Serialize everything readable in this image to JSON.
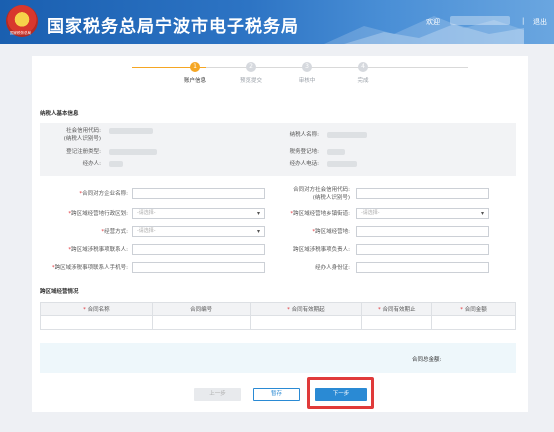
{
  "header": {
    "logo_text": "国家税务总局",
    "title": "国家税务总局宁波市电子税务局",
    "welcome": "欢迎",
    "separator": "|",
    "exit": "退出"
  },
  "steps": [
    {
      "num": "1",
      "label": "账户信息",
      "active": true
    },
    {
      "num": "2",
      "label": "预览提交",
      "active": false
    },
    {
      "num": "3",
      "label": "审核中",
      "active": false
    },
    {
      "num": "4",
      "label": "完成",
      "active": false
    }
  ],
  "basic_info": {
    "title": "纳税人基本信息",
    "fields": {
      "credit_code": "社会信用代码:",
      "credit_code_2": "(纳税人识别号)",
      "reg_type": "登记注册类型:",
      "operator": "经办人:",
      "taxpayer_name": "纳税人名称:",
      "tax_authority": "税务登记地:",
      "operator_phone": "经办人电话:"
    }
  },
  "form": {
    "counterparty_name": "合同对方企业名称:",
    "counterparty_code": "合同对方社会信用代码:",
    "counterparty_code_2": "(纳税人识别号)",
    "cross_district": "跨区域经营地行政区划:",
    "cross_street": "跨区域经营地乡镇街道:",
    "select_placeholder": "-请选择-",
    "business_mode": "经营方式:",
    "business_addr": "跨区域经营地:",
    "contact": "跨区域涉税事项联系人:",
    "manager": "跨区域涉税事项负责人:",
    "contact_phone": "跨区域涉税事项联系人手机号:",
    "operator_id": "经办人身份证:",
    "required_mark": "*"
  },
  "contract_section": {
    "title": "跨区域经营情况",
    "columns": [
      {
        "label": "合同名称",
        "required": true
      },
      {
        "label": "合同编号",
        "required": false
      },
      {
        "label": "合同有效期起",
        "required": true
      },
      {
        "label": "合同有效期止",
        "required": true
      },
      {
        "label": "合同金额",
        "required": true
      }
    ],
    "total_label": "合同总金额:"
  },
  "buttons": {
    "prev": "上一步",
    "save": "暂存",
    "next": "下一步"
  },
  "colors": {
    "accent": "#2a8ad4",
    "step_active": "#f5a623",
    "required": "#e0343a",
    "highlight": "#e03a3a"
  }
}
